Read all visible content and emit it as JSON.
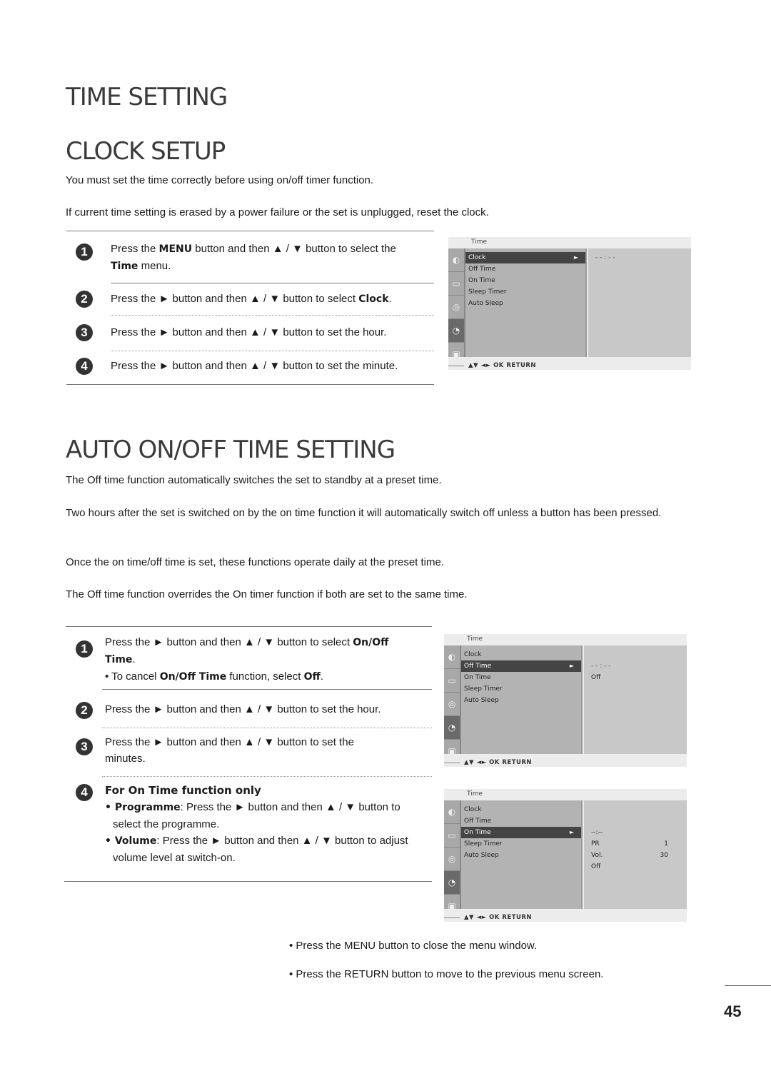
{
  "headings": {
    "time_setting": "TIME SETTING",
    "clock_setup": "CLOCK SETUP",
    "auto_onoff": "AUTO ON/OFF TIME SETTING"
  },
  "clock_setup": {
    "intro": [
      "You must set the time correctly before using on/off timer function.",
      "If current time setting is erased by a power failure or the set is unplugged, reset the clock."
    ],
    "steps": [
      {
        "num": "1",
        "pre": "Press the ",
        "b1": "MENU",
        "mid": " button and then ▲ / ▼ button to select the ",
        "b2": "Time",
        "post": "  menu."
      },
      {
        "num": "2",
        "pre": "Press the ► button and then ▲ / ▼ button to select ",
        "b1": "Clock",
        "post": "."
      },
      {
        "num": "3",
        "text": "Press the ► button and then ▲ / ▼ button to set the hour."
      },
      {
        "num": "4",
        "text": "Press the ► button and then ▲ / ▼ button to set the minute."
      }
    ]
  },
  "auto_onoff": {
    "paragraphs": [
      "The Off time function automatically switches the set to standby at a preset time.",
      "Two hours after the set is switched on by the on time function it will automatically switch off unless a button has been pressed.",
      "Once the on time/off time is set, these functions operate daily at the preset time.",
      "The Off time function overrides the On timer function if both are set to the same time."
    ],
    "steps": [
      {
        "num": "1",
        "pre": "Press the ► button and then ▲ / ▼ button to select ",
        "b1": "On/Off Time",
        "post": ".",
        "sub_pre": "• To cancel ",
        "sub_b1": "On/Off Time",
        "sub_mid": " function, select ",
        "sub_b2": "Off",
        "sub_post": "."
      },
      {
        "num": "2",
        "text": "Press the ► button and then ▲ / ▼ button to set the hour."
      },
      {
        "num": "3",
        "text": "Press the ► button and then ▲ / ▼ button to set the minutes."
      },
      {
        "num": "4",
        "title": "For On Time function only",
        "b1": "• Programme",
        "t1": ": Press the ► button and then ▲ / ▼ button to select the programme.",
        "b2": "• Volume",
        "t2": ": Press the ► button and then ▲ / ▼ button to adjust volume level at switch-on."
      }
    ]
  },
  "osd_common": {
    "title": "Time",
    "items": [
      "Clock",
      "Off Time",
      "On Time",
      "Sleep Timer",
      "Auto Sleep"
    ],
    "footer": "▲▼  ◄►  OK  RETURN",
    "arrow": "►",
    "icons": [
      "satellite-dish-icon",
      "tv-icon",
      "speaker-icon",
      "clock-icon",
      "toolbox-icon"
    ]
  },
  "osd_clock": {
    "selected": "Clock",
    "values": [
      "- - : - -"
    ]
  },
  "osd_offtime": {
    "selected": "Off Time",
    "values": [
      "- - : - -",
      "Off"
    ]
  },
  "osd_ontime": {
    "selected": "On Time",
    "time": "--:--",
    "pr_label": "PR",
    "pr_value": "1",
    "vol_label": "Vol.",
    "vol_value": "30",
    "state": "Off"
  },
  "notes": {
    "menu_pre": "• Press the ",
    "menu_b": "MENU",
    "menu_post": " button to close the menu window.",
    "return_pre": "• Press the ",
    "return_b": "RETURN",
    "return_post": " button to move to the previous menu screen."
  },
  "page_number": "45"
}
